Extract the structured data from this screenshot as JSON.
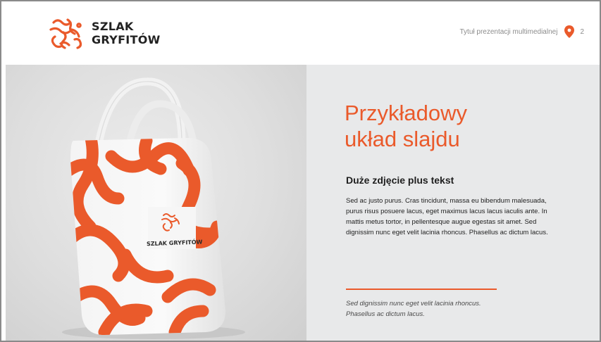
{
  "header": {
    "logo_line1": "SZLAK",
    "logo_line2": "GRYFITÓW",
    "presentation_title": "Tytuł prezentacji multimedialnej",
    "page_number": "2"
  },
  "photo": {
    "bag_brand": "SZLAK GRYFITÓW",
    "icon": "tote-bag-mockup"
  },
  "content": {
    "title_line1": "Przykładowy",
    "title_line2": "układ slajdu",
    "subtitle": "Duże zdjęcie plus tekst",
    "body": "Sed ac justo purus. Cras tincidunt, massa eu bibendum malesuada, purus risus posuere lacus, eget maximus lacus lacus iaculis ante. In mattis metus tortor, in pellentesque augue egestas sit amet. Sed dignissim nunc eget velit lacinia rhoncus. Phasellus ac dictum lacus.",
    "quote_line1": "Sed dignissim nunc eget velit lacinia rhoncus.",
    "quote_line2": "Phasellus ac dictum lacus."
  },
  "colors": {
    "accent": "#ea5a2b",
    "text": "#1e1e1e",
    "panel_bg": "#e8e9ea",
    "muted": "#8c8c8c"
  }
}
